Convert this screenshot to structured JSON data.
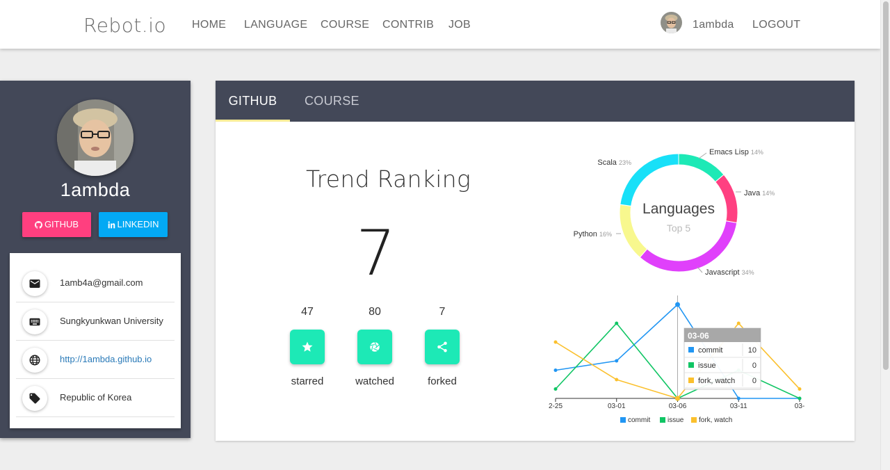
{
  "nav": {
    "brand": "Rebot.io",
    "links": [
      "HOME",
      "LANGUAGE",
      "COURSE",
      "CONTRIB",
      "JOB"
    ],
    "username": "1ambda",
    "logout": "LOGOUT"
  },
  "profile": {
    "name": "1ambda",
    "github_label": "GITHUB",
    "linkedin_label": "LINKEDIN",
    "info": [
      {
        "icon": "email-icon",
        "text": "1amb4a@gmail.com"
      },
      {
        "icon": "keyboard-icon",
        "text": "Sungkyunkwan University"
      },
      {
        "icon": "globe-icon",
        "text": "http://1ambda.github.io"
      },
      {
        "icon": "tag-icon",
        "text": "Republic of Korea"
      }
    ]
  },
  "tabs": [
    "GITHUB",
    "COURSE"
  ],
  "trend": {
    "title": "Trend Ranking",
    "rank": "7",
    "stats": [
      {
        "count": "47",
        "label": "starred",
        "icon": "star-icon"
      },
      {
        "count": "80",
        "label": "watched",
        "icon": "aperture-icon"
      },
      {
        "count": "7",
        "label": "forked",
        "icon": "share-icon"
      }
    ]
  },
  "chart_data": [
    {
      "type": "pie",
      "title": "Languages",
      "subtitle": "Top 5",
      "labels": [
        "Emacs Lisp",
        "Java",
        "Javascript",
        "Python",
        "Scala"
      ],
      "values": [
        14,
        14,
        34,
        16,
        23
      ],
      "value_labels": [
        "14%",
        "14%",
        "34%",
        "16%",
        "23%"
      ],
      "colors": [
        "#1de9b6",
        "#ff4081",
        "#e040fb",
        "#f8f88e",
        "#18e0f8"
      ]
    },
    {
      "type": "line",
      "x_tick_labels": [
        "2-25",
        "03-01",
        "03-06",
        "03-11",
        "03-"
      ],
      "x": [
        0,
        1,
        2,
        3,
        4
      ],
      "series": [
        {
          "name": "commit",
          "color": "#2196f3",
          "values": [
            3,
            4,
            10,
            0,
            0
          ]
        },
        {
          "name": "issue",
          "color": "#10c564",
          "values": [
            1,
            8,
            0,
            3,
            0
          ]
        },
        {
          "name": "fork, watch",
          "color": "#fbc02d",
          "values": [
            6,
            2,
            0,
            8,
            1
          ]
        }
      ],
      "ylim": [
        0,
        10
      ],
      "legend": "bottom",
      "tooltip": {
        "title": "03-06",
        "rows": [
          {
            "name": "commit",
            "value": "10"
          },
          {
            "name": "issue",
            "value": "0"
          },
          {
            "name": "fork, watch",
            "value": "0"
          }
        ]
      }
    }
  ]
}
